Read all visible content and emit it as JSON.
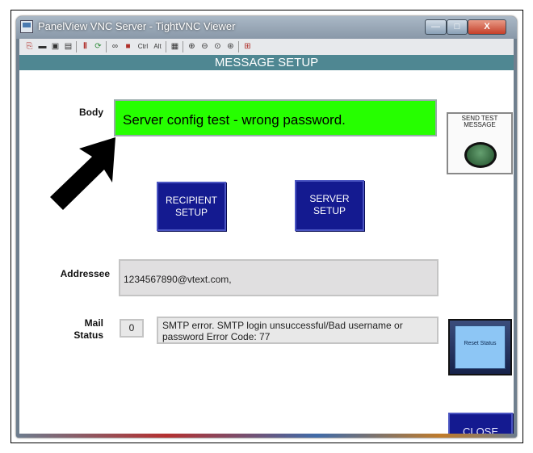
{
  "window": {
    "title": "PanelView VNC Server - TightVNC Viewer",
    "min_glyph": "—",
    "max_glyph": "□",
    "close_glyph": "X"
  },
  "toolbar": {
    "icons": [
      "new-connection-icon",
      "save-icon",
      "properties-icon",
      "info-icon",
      "pause-icon",
      "refresh-icon",
      "toggle-fullscreen-icon",
      "send-ctrl-alt-del-icon",
      "ctrl-key-icon",
      "alt-key-icon",
      "clipboard-icon",
      "zoom-in-icon",
      "zoom-out-icon",
      "zoom-100-icon",
      "zoom-auto-icon",
      "fullscreen-icon"
    ],
    "ctrl_label": "Ctrl",
    "alt_label": "Alt"
  },
  "screen": {
    "header": "MESSAGE SETUP",
    "body_label": "Body",
    "body_value": "Server config test - wrong password.",
    "send_button_label": "SEND TEST MESSAGE",
    "recipient_button_label": "RECIPIENT SETUP",
    "server_button_label": "SERVER SETUP",
    "addressee_label": "Addressee",
    "addressee_value": "1234567890@vtext.com,",
    "mail_status_label": "Mail Status",
    "status_code": "0",
    "status_text": "SMTP error. SMTP login unsuccessful/Bad username or password Error Code: 77",
    "reset_button_label": "Reset Status",
    "close_button_label": "CLOSE"
  },
  "colors": {
    "header_bg": "#4f8792",
    "body_field_bg": "#26ff00",
    "button_navy": "#141a90"
  }
}
